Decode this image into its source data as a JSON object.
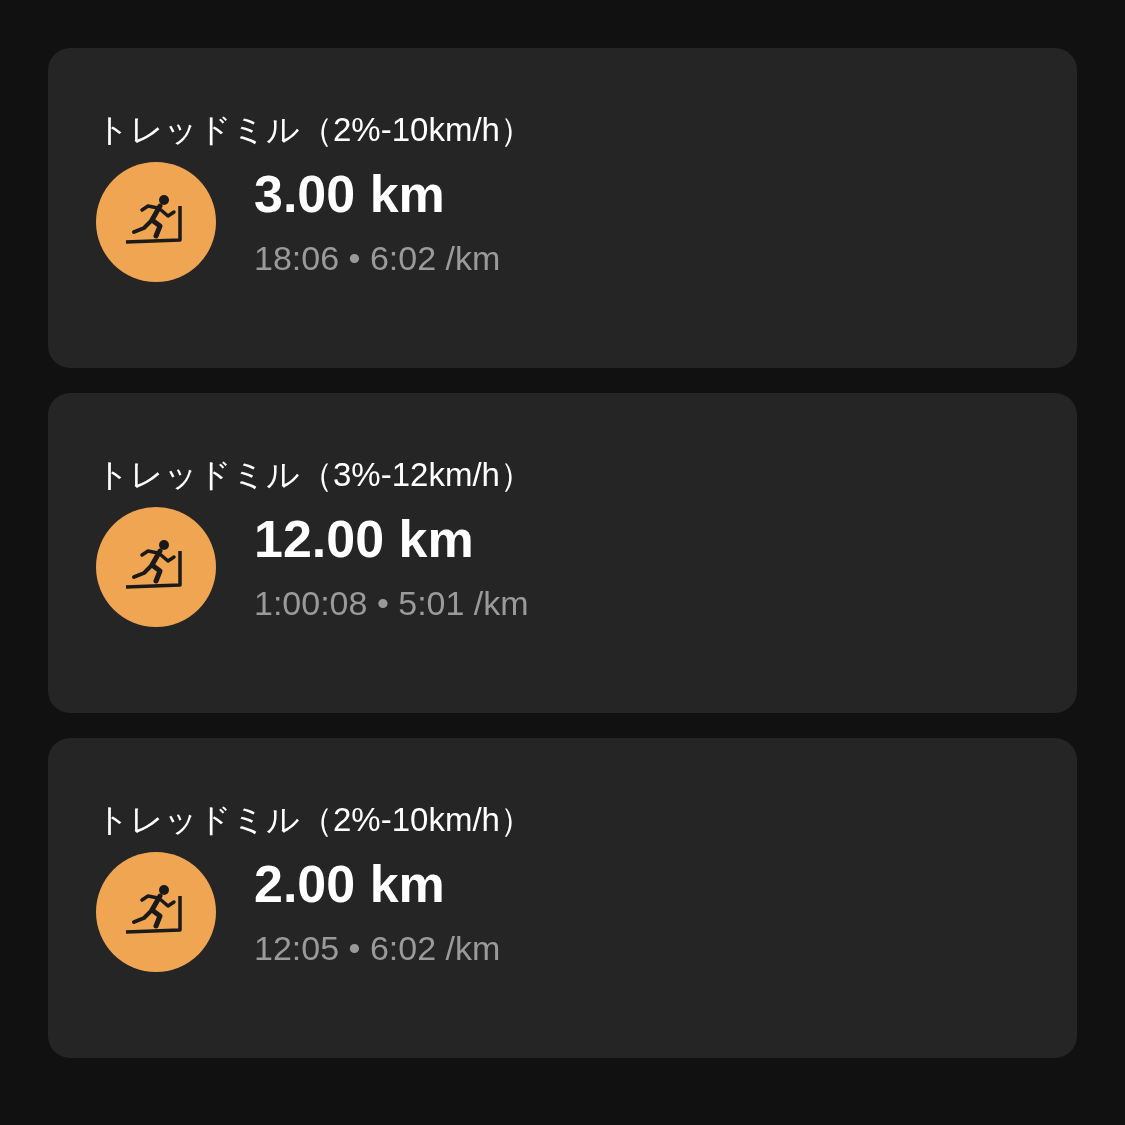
{
  "activities": [
    {
      "title": "トレッドミル（2%-10km/h）",
      "distance": "3.00 km",
      "details": "18:06 • 6:02 /km"
    },
    {
      "title": "トレッドミル（3%-12km/h）",
      "distance": "12.00 km",
      "details": "1:00:08 • 5:01 /km"
    },
    {
      "title": "トレッドミル（2%-10km/h）",
      "distance": "2.00 km",
      "details": "12:05 • 6:02 /km"
    }
  ]
}
